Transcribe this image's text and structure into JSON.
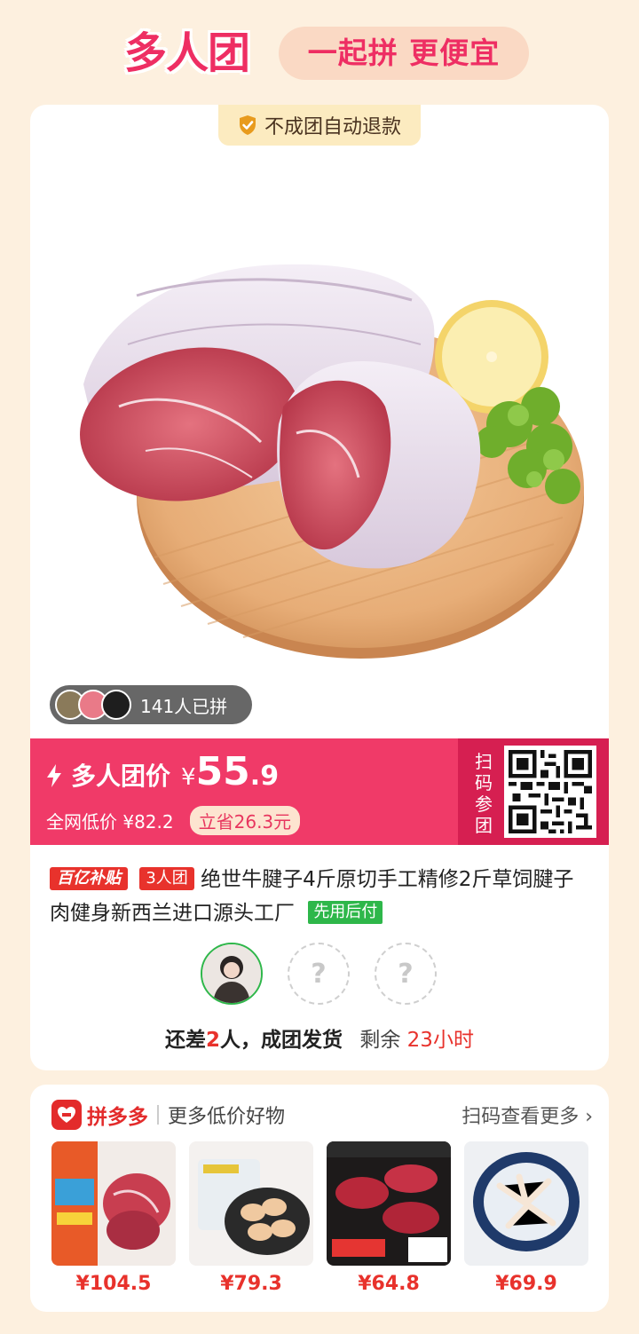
{
  "header": {
    "brand_title": "多人团",
    "slogan": "一起拼 更便宜"
  },
  "card": {
    "refund_tag": "不成团自动退款",
    "joined_count": "141人已拼",
    "price": {
      "label": "多人团价",
      "currency": "¥",
      "integer": "55",
      "decimal": ".9",
      "original": "全网低价 ¥82.2",
      "save": "立省26.3元"
    },
    "scan": {
      "text": [
        "扫",
        "码",
        "参",
        "团"
      ]
    },
    "title": {
      "tag_subsidy": "百亿补贴",
      "tag_group": "3人团",
      "text": "绝世牛腱子4斤原切手工精修2斤草饲腱子肉健身新西兰进口源头工厂",
      "tag_paylater": "先用后付"
    },
    "slots": {
      "empty_mark": "?"
    },
    "status": {
      "prefix": "还差",
      "count": "2",
      "suffix": "人，成团发货",
      "remain_label": "剩余",
      "remain_time": "23小时"
    }
  },
  "more": {
    "brand": "拼多多",
    "subtitle": "更多低价好物",
    "link": "扫码查看更多 ›",
    "goods": [
      {
        "price": "¥104.5",
        "icon": "beef-shank-thumb"
      },
      {
        "price": "¥79.3",
        "icon": "chicken-wings-thumb"
      },
      {
        "price": "¥64.8",
        "icon": "steak-box-thumb"
      },
      {
        "price": "¥69.9",
        "icon": "chicken-feet-thumb"
      }
    ]
  },
  "colors": {
    "accent": "#f03a68",
    "dark_accent": "#d61f51",
    "green": "#2eb74a",
    "red": "#e8322c"
  }
}
